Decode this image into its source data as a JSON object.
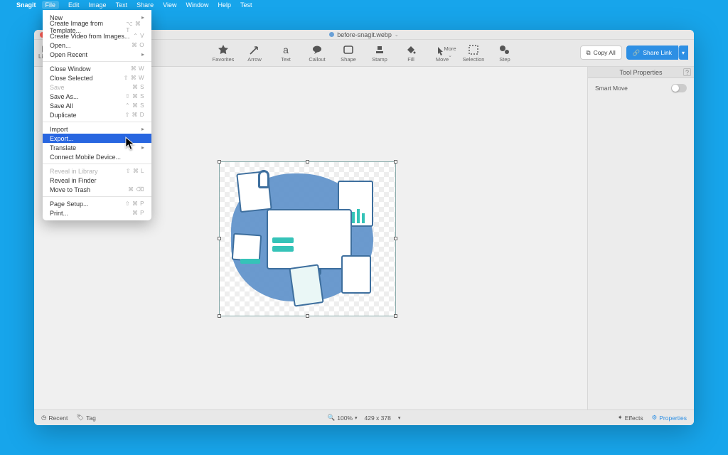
{
  "menubar": {
    "app": "Snagit",
    "items": [
      "File",
      "Edit",
      "Image",
      "Text",
      "Share",
      "View",
      "Window",
      "Help",
      "Test"
    ]
  },
  "window": {
    "title": "before-snagit.webp",
    "library": "Library",
    "tools": [
      {
        "id": "favorites",
        "label": "Favorites"
      },
      {
        "id": "arrow",
        "label": "Arrow"
      },
      {
        "id": "text",
        "label": "Text"
      },
      {
        "id": "callout",
        "label": "Callout"
      },
      {
        "id": "shape",
        "label": "Shape"
      },
      {
        "id": "stamp",
        "label": "Stamp"
      },
      {
        "id": "fill",
        "label": "Fill"
      },
      {
        "id": "move",
        "label": "Move"
      },
      {
        "id": "selection",
        "label": "Selection"
      },
      {
        "id": "step",
        "label": "Step"
      }
    ],
    "more": "More",
    "copy_all": "Copy All",
    "share": "Share Link"
  },
  "sidepanel": {
    "title": "Tool Properties",
    "smart_move": "Smart Move"
  },
  "statusbar": {
    "recent": "Recent",
    "tag": "Tag",
    "zoom": "100%",
    "dims": "429 x 378",
    "effects": "Effects",
    "properties": "Properties"
  },
  "file_menu": [
    {
      "t": "row",
      "label": "New",
      "arrow": true
    },
    {
      "t": "row",
      "label": "Create Image from Template...",
      "sc": "⌥ ⌘ T"
    },
    {
      "t": "row",
      "label": "Create Video from Images...",
      "sc": "⌃ V"
    },
    {
      "t": "row",
      "label": "Open...",
      "sc": "⌘ O"
    },
    {
      "t": "row",
      "label": "Open Recent",
      "arrow": true
    },
    {
      "t": "sep"
    },
    {
      "t": "row",
      "label": "Close Window",
      "sc": "⌘ W"
    },
    {
      "t": "row",
      "label": "Close Selected",
      "sc": "⇧ ⌘ W"
    },
    {
      "t": "row",
      "label": "Save",
      "sc": "⌘ S",
      "dis": true
    },
    {
      "t": "row",
      "label": "Save As...",
      "sc": "⇧ ⌘ S"
    },
    {
      "t": "row",
      "label": "Save All",
      "sc": "⌃ ⌘ S"
    },
    {
      "t": "row",
      "label": "Duplicate",
      "sc": "⇧ ⌘ D"
    },
    {
      "t": "sep"
    },
    {
      "t": "row",
      "label": "Import",
      "arrow": true
    },
    {
      "t": "row",
      "label": "Export...",
      "hl": true
    },
    {
      "t": "row",
      "label": "Translate",
      "arrow": true
    },
    {
      "t": "row",
      "label": "Connect Mobile Device..."
    },
    {
      "t": "sep"
    },
    {
      "t": "row",
      "label": "Reveal in Library",
      "sc": "⇧ ⌘ L",
      "dis": true
    },
    {
      "t": "row",
      "label": "Reveal in Finder"
    },
    {
      "t": "row",
      "label": "Move to Trash",
      "sc": "⌘ ⌫"
    },
    {
      "t": "sep"
    },
    {
      "t": "row",
      "label": "Page Setup...",
      "sc": "⇧ ⌘ P"
    },
    {
      "t": "row",
      "label": "Print...",
      "sc": "⌘ P"
    }
  ]
}
